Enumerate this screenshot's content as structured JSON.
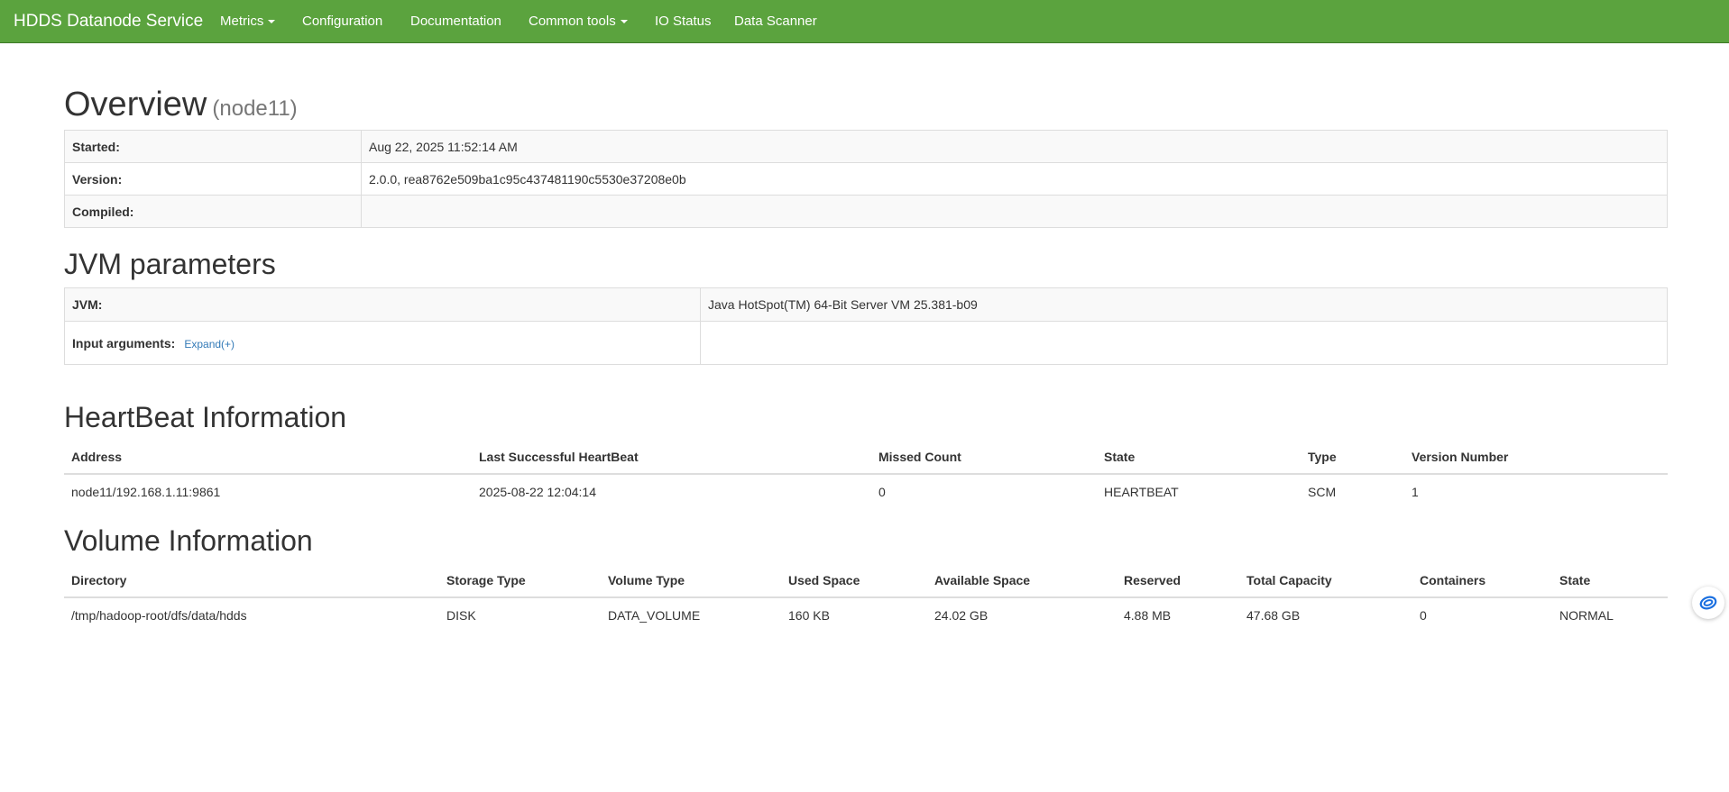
{
  "nav": {
    "brand": "HDDS Datanode Service",
    "items": [
      {
        "label": "Metrics",
        "dropdown": true
      },
      {
        "label": "Configuration",
        "dropdown": false
      },
      {
        "label": "Documentation",
        "dropdown": false
      },
      {
        "label": "Common tools",
        "dropdown": true
      },
      {
        "label": "IO Status",
        "dropdown": false
      },
      {
        "label": "Data Scanner",
        "dropdown": false
      }
    ],
    "color": "#5ba33e"
  },
  "overview": {
    "title": "Overview",
    "hostname": "(node11)",
    "rows": [
      {
        "key": "Started:",
        "value": "Aug 22, 2025 11:52:14 AM"
      },
      {
        "key": "Version:",
        "value": "2.0.0, rea8762e509ba1c95c437481190c5530e37208e0b"
      },
      {
        "key": "Compiled:",
        "value": ""
      }
    ]
  },
  "jvm": {
    "title": "JVM parameters",
    "jvm_label": "JVM:",
    "jvm_value": "Java HotSpot(TM) 64-Bit Server VM 25.381-b09",
    "input_args_label": "Input arguments:",
    "expand_label": "Expand(+)",
    "input_args_value": ""
  },
  "heartbeat": {
    "title": "HeartBeat Information",
    "columns": [
      "Address",
      "Last Successful HeartBeat",
      "Missed Count",
      "State",
      "Type",
      "Version Number"
    ],
    "rows": [
      [
        "node11/192.168.1.11:9861",
        "2025-08-22 12:04:14",
        "0",
        "HEARTBEAT",
        "SCM",
        "1"
      ]
    ]
  },
  "volume": {
    "title": "Volume Information",
    "columns": [
      "Directory",
      "Storage Type",
      "Volume Type",
      "Used Space",
      "Available Space",
      "Reserved",
      "Total Capacity",
      "Containers",
      "State"
    ],
    "rows": [
      [
        "/tmp/hadoop-root/dfs/data/hdds",
        "DISK",
        "DATA_VOLUME",
        "160 KB",
        "24.02 GB",
        "4.88 MB",
        "47.68 GB",
        "0",
        "NORMAL"
      ]
    ]
  },
  "floating_button": {
    "icon": "assistant-logo-icon",
    "color": "#1a6fe0"
  }
}
